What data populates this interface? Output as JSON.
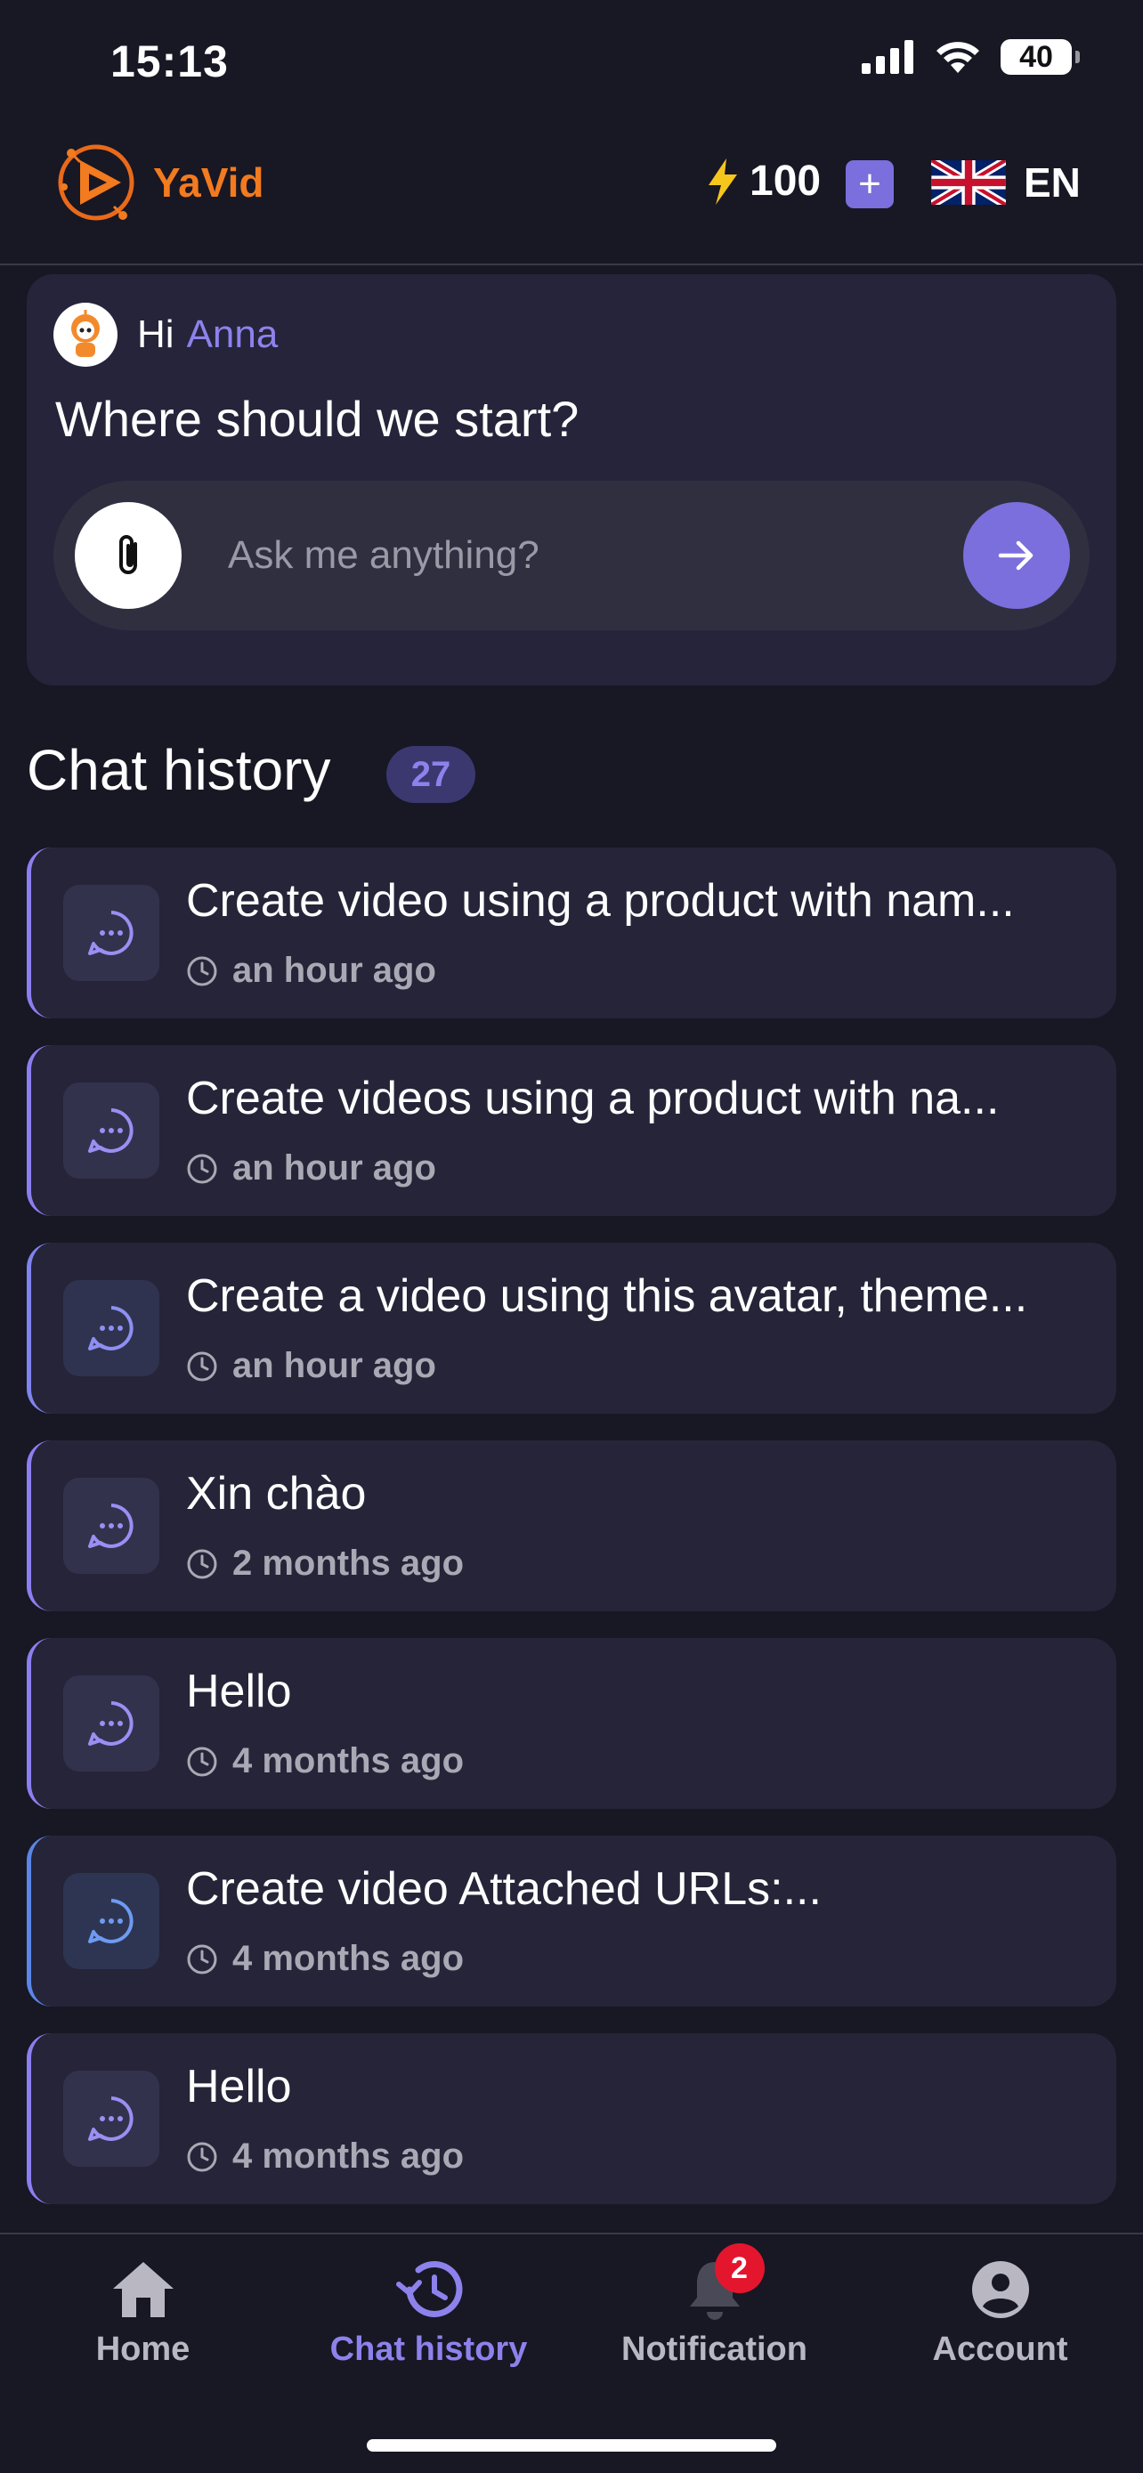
{
  "status_bar": {
    "time": "15:13",
    "battery": "40"
  },
  "header": {
    "app_name": "YaVid",
    "credits": "100",
    "plus_label": "+",
    "language": "EN"
  },
  "greeting": {
    "hi": "Hi",
    "name": "Anna",
    "question": "Where should we start?",
    "input_placeholder": "Ask me anything?"
  },
  "chat_history": {
    "title": "Chat history",
    "count": "27",
    "items": [
      {
        "title": "Create video using a product with nam...",
        "time": "an hour ago"
      },
      {
        "title": "Create videos using a product with na...",
        "time": "an hour ago"
      },
      {
        "title": "Create a video using this avatar, theme...",
        "time": "an hour ago"
      },
      {
        "title": "Xin chào",
        "time": "2 months ago"
      },
      {
        "title": "Hello",
        "time": "4 months ago"
      },
      {
        "title": "Create video Attached URLs:...",
        "time": "4 months ago"
      },
      {
        "title": "Hello",
        "time": "4 months ago"
      }
    ]
  },
  "nav": {
    "items": [
      {
        "label": "Home",
        "icon": "home-icon"
      },
      {
        "label": "Chat history",
        "icon": "history-icon"
      },
      {
        "label": "Notification",
        "icon": "bell-icon",
        "badge": "2"
      },
      {
        "label": "Account",
        "icon": "account-icon"
      }
    ],
    "active": "Chat history"
  },
  "colors": {
    "background": "#181724",
    "card": "#252438",
    "accent": "#7a6fdc",
    "brand_orange": "#f27a1f",
    "badge_red": "#e3162d"
  }
}
